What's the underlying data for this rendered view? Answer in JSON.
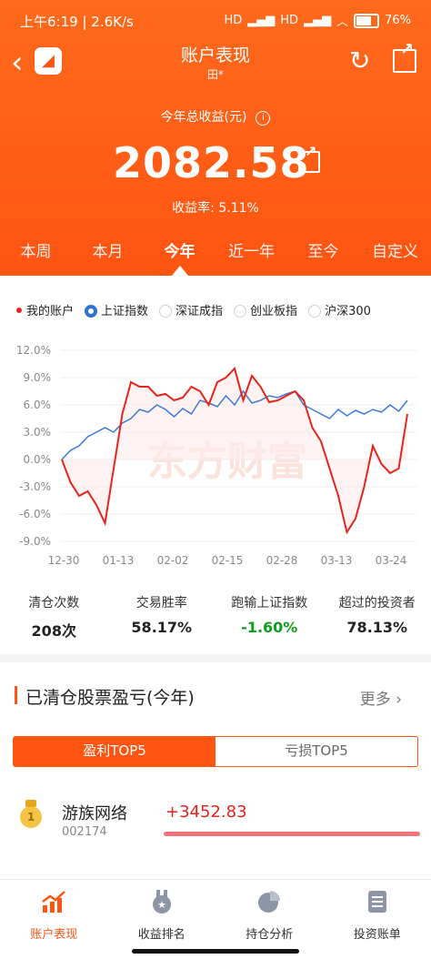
{
  "status": {
    "time": "上午6:19",
    "speed": "2.6K/s",
    "net1": "HD",
    "net2": "HD",
    "battery": "76%"
  },
  "header": {
    "title": "账户表现",
    "subtitle": "田*",
    "total_label": "今年总收益(元)",
    "total_value": "2082.58",
    "rate_text": "收益率: 5.11%"
  },
  "tabs": [
    "本周",
    "本月",
    "今年",
    "近一年",
    "至今",
    "自定义"
  ],
  "active_tab": 2,
  "legend": {
    "my_account": "我的账户",
    "options": [
      "上证指数",
      "深证成指",
      "创业板指",
      "沪深300"
    ],
    "selected": 0
  },
  "chart_data": {
    "type": "line",
    "y_ticks": [
      "12.0%",
      "9.0%",
      "6.0%",
      "3.0%",
      "0.0%",
      "-3.0%",
      "-6.0%",
      "-9.0%"
    ],
    "x_ticks": [
      "12-30",
      "01-13",
      "02-02",
      "02-15",
      "02-28",
      "03-13",
      "03-24"
    ],
    "ylim": [
      -9,
      12
    ],
    "grid": true,
    "watermark": "东方财富",
    "series": [
      {
        "name": "我的账户",
        "color": "#e8231a",
        "values": [
          0.0,
          -2.5,
          -4.0,
          -3.5,
          -5.0,
          -7.0,
          -1.0,
          5.0,
          8.5,
          8.0,
          8.0,
          7.0,
          7.2,
          6.5,
          6.8,
          8.0,
          7.5,
          6.0,
          8.5,
          9.0,
          10.0,
          6.5,
          9.2,
          8.0,
          6.3,
          6.5,
          7.0,
          7.5,
          6.5,
          3.5,
          2.0,
          -1.0,
          -4.0,
          -8.0,
          -6.5,
          -3.0,
          1.5,
          -0.5,
          -1.5,
          -1.0,
          5.0
        ]
      },
      {
        "name": "上证指数",
        "color": "#3a7bd5",
        "values": [
          0.0,
          1.0,
          1.5,
          2.5,
          3.0,
          3.5,
          3.0,
          4.0,
          4.5,
          5.5,
          5.2,
          6.0,
          5.5,
          4.7,
          5.6,
          5.0,
          6.5,
          6.2,
          5.8,
          7.0,
          6.0,
          7.5,
          6.2,
          6.5,
          7.0,
          6.8,
          7.2,
          7.5,
          6.0,
          5.5,
          5.0,
          4.5,
          5.5,
          4.8,
          5.4,
          5.0,
          5.5,
          5.2,
          6.0,
          5.3,
          6.5
        ]
      }
    ]
  },
  "stats": [
    {
      "key": "清仓次数",
      "value": "208次"
    },
    {
      "key": "交易胜率",
      "value": "58.17%"
    },
    {
      "key": "跑输上证指数",
      "value": "-1.60%",
      "color": "#0f9d1e"
    },
    {
      "key": "超过的投资者",
      "value": "78.13%"
    }
  ],
  "section": {
    "title": "已清仓股票盈亏(今年)",
    "more": "更多 ›",
    "seg_profit": "盈利TOP5",
    "seg_loss": "亏损TOP5",
    "rank": "1",
    "stock_name": "游族网络",
    "stock_code": "002174",
    "stock_pnl": "+3452.83"
  },
  "bottom_nav": [
    "账户表现",
    "收益排名",
    "持仓分析",
    "投资账单"
  ],
  "colors": {
    "accent": "#ff5412",
    "red": "#e8231a",
    "blue": "#3a7bd5",
    "green": "#0f9d1e"
  }
}
